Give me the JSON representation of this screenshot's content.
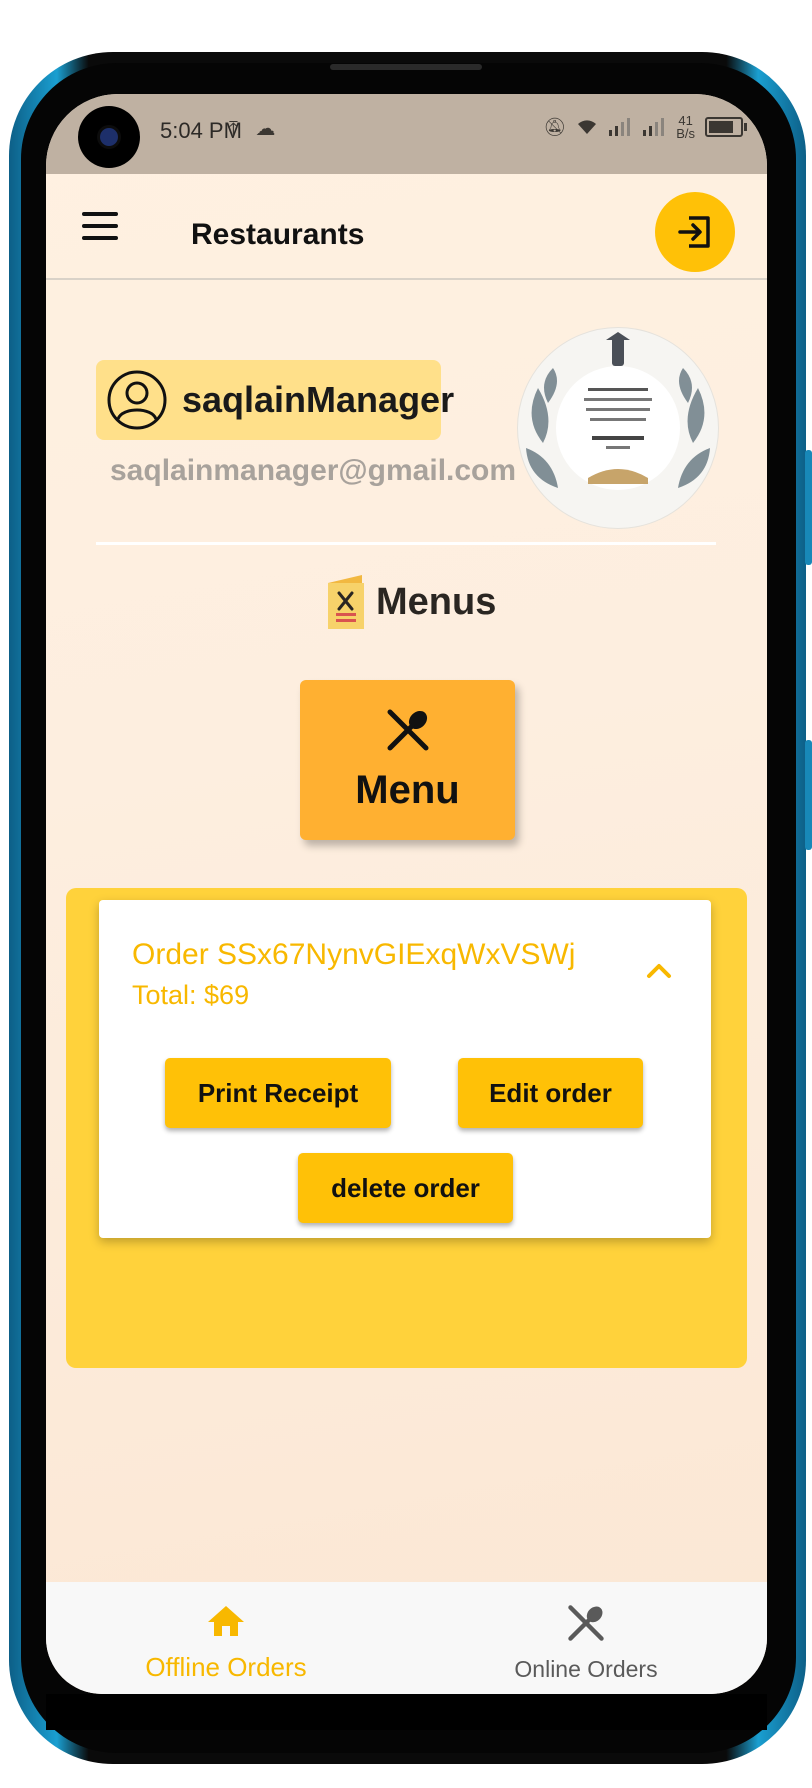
{
  "status_bar": {
    "time": "5:04 PM",
    "network_speed_value": "41",
    "network_speed_unit": "B/s"
  },
  "app_bar": {
    "title": "Restaurants",
    "menu_icon": "hamburger-icon",
    "logout_icon": "logout-icon"
  },
  "profile": {
    "name": "saqlainManager",
    "email": "saqlainmanager@gmail.com"
  },
  "menus": {
    "section_label": "Menus",
    "card_label": "Menu",
    "card_icon": "utensils-icon"
  },
  "order": {
    "id_text": "Order SSx67NynvGIExqWxVSWj",
    "total_text": "Total: $69",
    "print_label": "Print Receipt",
    "edit_label": "Edit order",
    "delete_label": "delete order"
  },
  "bottom_nav": {
    "items": [
      {
        "label": "Offline Orders",
        "icon": "home-icon",
        "active": true
      },
      {
        "label": "Online Orders",
        "icon": "utensils-icon",
        "active": false
      }
    ]
  },
  "colors": {
    "accent": "#ffc107",
    "panel": "#ffd23b",
    "active_text": "#f8b800"
  }
}
